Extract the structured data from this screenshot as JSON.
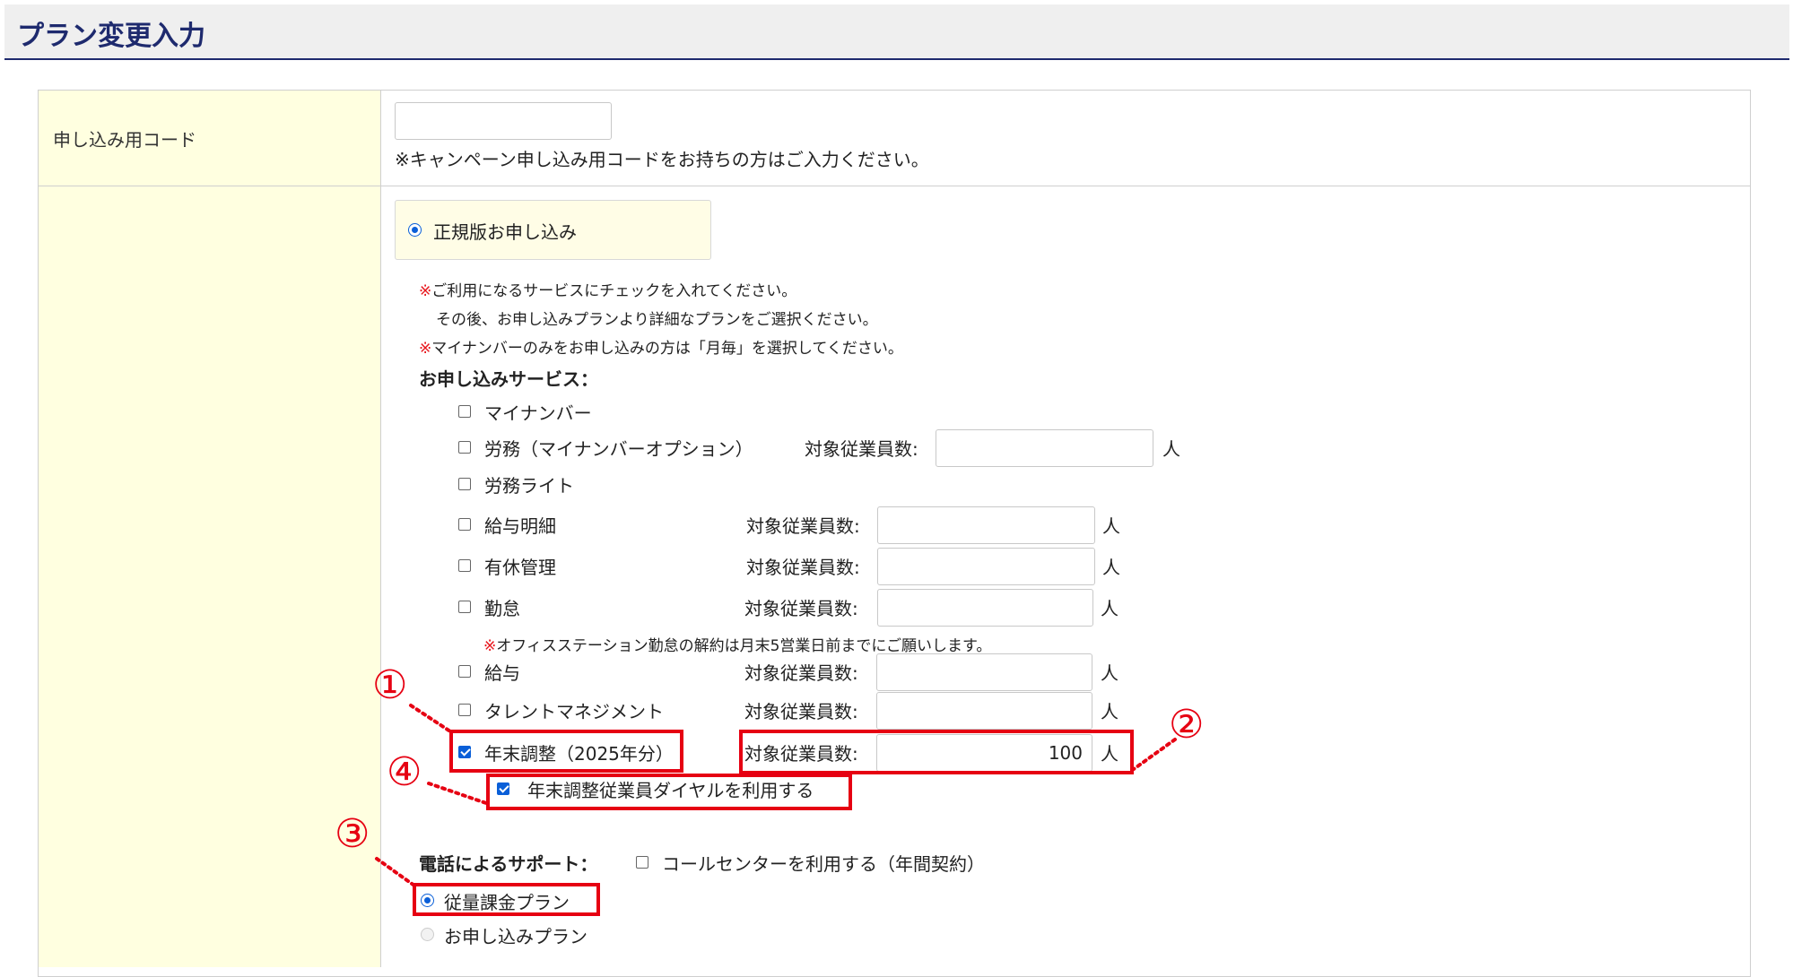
{
  "page_title": "プラン変更入力",
  "campaign": {
    "label": "申し込み用コード",
    "value": "",
    "note": "※キャンペーン申し込み用コードをお持ちの方はご入力ください。"
  },
  "plan_option": "正規版お申し込み",
  "notes": {
    "mark": "※",
    "line1": "ご利用になるサービスにチェックを入れてください。",
    "line2": "その後、お申し込みプランより詳細なプランをご選択ください。",
    "line3": "マイナンバーのみをお申し込みの方は「月毎」を選択してください。"
  },
  "services_heading": "お申し込みサービス：",
  "employee_label": "対象従業員数:",
  "unit": "人",
  "services": {
    "mynumber": "マイナンバー",
    "roumu": "労務（マイナンバーオプション）",
    "roumu_lite": "労務ライト",
    "kyuyo_meisai": "給与明細",
    "yukyu": "有休管理",
    "kintai": "勤怠",
    "kintai_note": "オフィスステーション勤怠の解約は月末5営業日前までにご願いします。",
    "kyuyo": "給与",
    "talent": "タレントマネジメント",
    "nenmatsu": "年末調整（2025年分）",
    "nenmatsu_count": "100",
    "nenmatsu_dial": "年末調整従業員ダイヤルを利用する"
  },
  "support": {
    "label": "電話によるサポート：",
    "callcenter": "コールセンターを利用する（年間契約）"
  },
  "plans": {
    "jyuryo": "従量課金プラン",
    "moushikomi": "お申し込みプラン"
  },
  "markers": {
    "m1": "①",
    "m2": "②",
    "m3": "③",
    "m4": "④"
  },
  "colors": {
    "title": "#1e2a6e",
    "label_bg": "#ffffe0",
    "note_red": "#e8141b",
    "highlight": "#e60012",
    "check": "#0a5fd8"
  }
}
